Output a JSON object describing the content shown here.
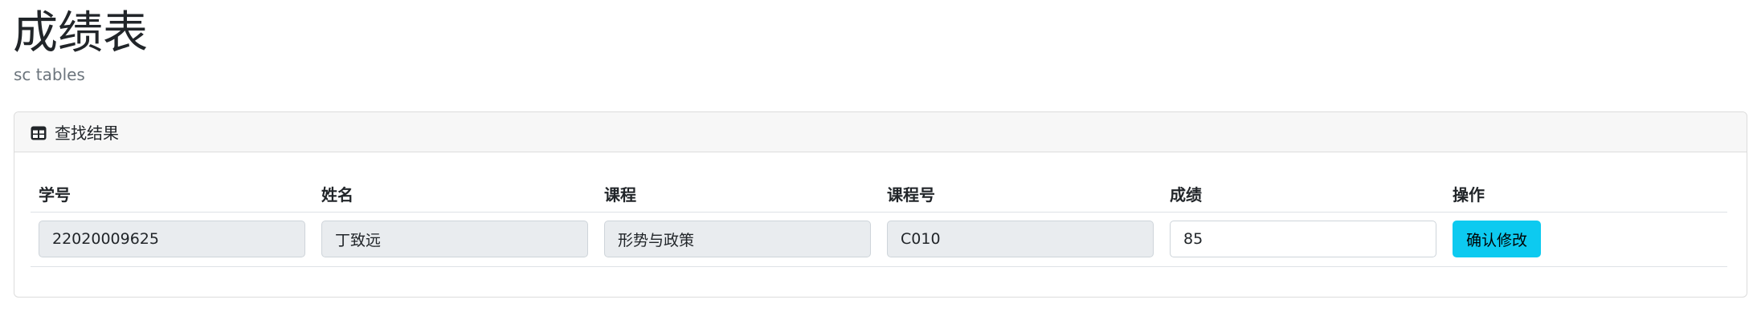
{
  "page": {
    "title": "成绩表",
    "subtitle": "sc tables"
  },
  "card": {
    "header_icon": "table-icon",
    "header_title": "查找结果"
  },
  "table": {
    "columns": [
      "学号",
      "姓名",
      "课程",
      "课程号",
      "成绩",
      "操作"
    ],
    "rows": [
      {
        "student_id": "22020009625",
        "name": "丁致远",
        "course": "形势与政策",
        "course_id": "C010",
        "score": "85",
        "action_label": "确认修改"
      }
    ]
  },
  "colors": {
    "accent_button": "#0dcaf0",
    "readonly_field_bg": "#e9ecef",
    "header_bg": "#f7f7f7"
  }
}
